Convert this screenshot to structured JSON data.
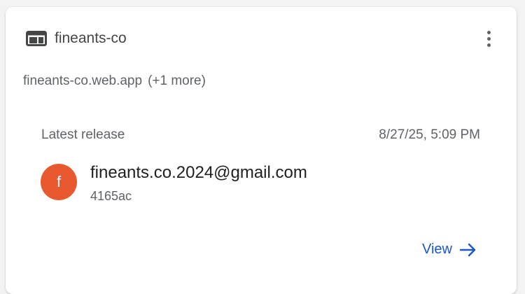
{
  "site": {
    "title": "fineants-co",
    "icon": "web-hosting-icon",
    "domain": "fineants-co.web.app",
    "more_domains": "(+1 more)"
  },
  "menu": {
    "icon": "more-vert-icon"
  },
  "release": {
    "label": "Latest release",
    "time": "8/27/25, 5:09 PM",
    "avatar_letter": "f",
    "avatar_color": "#e8592f",
    "email": "fineants.co.2024@gmail.com",
    "commit": "4165ac"
  },
  "actions": {
    "view_label": "View",
    "view_icon": "arrow-right-icon",
    "accent": "#1a57c8"
  }
}
